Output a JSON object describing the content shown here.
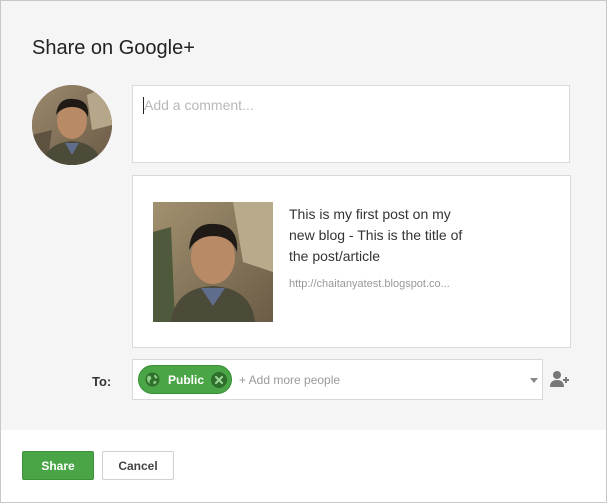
{
  "dialog": {
    "title": "Share on Google+"
  },
  "composer": {
    "comment_placeholder": "Add a comment..."
  },
  "preview": {
    "title": "This is my first post on my new blog - This is the title of the post/article",
    "url": "http://chaitanyatest.blogspot.co..."
  },
  "audience": {
    "to_label": "To:",
    "chip_label": "Public",
    "add_more_placeholder": "+ Add more people"
  },
  "footer": {
    "share_label": "Share",
    "cancel_label": "Cancel"
  },
  "colors": {
    "accent_green": "#4aa546",
    "dialog_background": "#f5f5f5"
  }
}
